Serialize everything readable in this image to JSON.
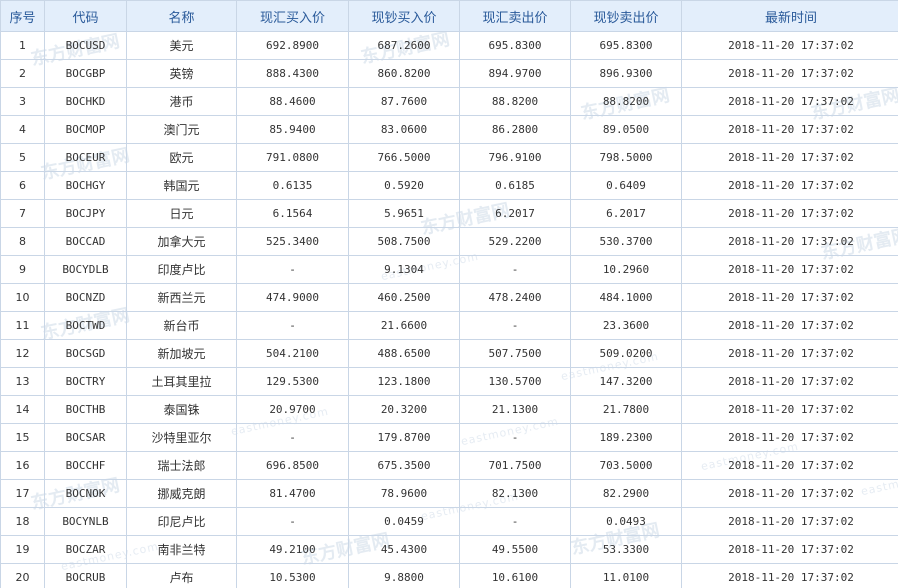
{
  "watermark": {
    "cn": "东方财富网",
    "en": "eastmoney.com"
  },
  "columns": [
    "序号",
    "代码",
    "名称",
    "现汇买入价",
    "现钞买入价",
    "现汇卖出价",
    "现钞卖出价",
    "最新时间"
  ],
  "rows": [
    {
      "idx": "1",
      "code": "BOCUSD",
      "name": "美元",
      "fx_buy": "692.8900",
      "cash_buy": "687.2600",
      "fx_sell": "695.8300",
      "cash_sell": "695.8300",
      "time": "2018-11-20 17:37:02"
    },
    {
      "idx": "2",
      "code": "BOCGBP",
      "name": "英镑",
      "fx_buy": "888.4300",
      "cash_buy": "860.8200",
      "fx_sell": "894.9700",
      "cash_sell": "896.9300",
      "time": "2018-11-20 17:37:02"
    },
    {
      "idx": "3",
      "code": "BOCHKD",
      "name": "港币",
      "fx_buy": "88.4600",
      "cash_buy": "87.7600",
      "fx_sell": "88.8200",
      "cash_sell": "88.8200",
      "time": "2018-11-20 17:37:02"
    },
    {
      "idx": "4",
      "code": "BOCMOP",
      "name": "澳门元",
      "fx_buy": "85.9400",
      "cash_buy": "83.0600",
      "fx_sell": "86.2800",
      "cash_sell": "89.0500",
      "time": "2018-11-20 17:37:02"
    },
    {
      "idx": "5",
      "code": "BOCEUR",
      "name": "欧元",
      "fx_buy": "791.0800",
      "cash_buy": "766.5000",
      "fx_sell": "796.9100",
      "cash_sell": "798.5000",
      "time": "2018-11-20 17:37:02"
    },
    {
      "idx": "6",
      "code": "BOCHGY",
      "name": "韩国元",
      "fx_buy": "0.6135",
      "cash_buy": "0.5920",
      "fx_sell": "0.6185",
      "cash_sell": "0.6409",
      "time": "2018-11-20 17:37:02"
    },
    {
      "idx": "7",
      "code": "BOCJPY",
      "name": "日元",
      "fx_buy": "6.1564",
      "cash_buy": "5.9651",
      "fx_sell": "6.2017",
      "cash_sell": "6.2017",
      "time": "2018-11-20 17:37:02"
    },
    {
      "idx": "8",
      "code": "BOCCAD",
      "name": "加拿大元",
      "fx_buy": "525.3400",
      "cash_buy": "508.7500",
      "fx_sell": "529.2200",
      "cash_sell": "530.3700",
      "time": "2018-11-20 17:37:02"
    },
    {
      "idx": "9",
      "code": "BOCYDLB",
      "name": "印度卢比",
      "fx_buy": "-",
      "cash_buy": "9.1304",
      "fx_sell": "-",
      "cash_sell": "10.2960",
      "time": "2018-11-20 17:37:02"
    },
    {
      "idx": "10",
      "code": "BOCNZD",
      "name": "新西兰元",
      "fx_buy": "474.9000",
      "cash_buy": "460.2500",
      "fx_sell": "478.2400",
      "cash_sell": "484.1000",
      "time": "2018-11-20 17:37:02"
    },
    {
      "idx": "11",
      "code": "BOCTWD",
      "name": "新台币",
      "fx_buy": "-",
      "cash_buy": "21.6600",
      "fx_sell": "-",
      "cash_sell": "23.3600",
      "time": "2018-11-20 17:37:02"
    },
    {
      "idx": "12",
      "code": "BOCSGD",
      "name": "新加坡元",
      "fx_buy": "504.2100",
      "cash_buy": "488.6500",
      "fx_sell": "507.7500",
      "cash_sell": "509.0200",
      "time": "2018-11-20 17:37:02"
    },
    {
      "idx": "13",
      "code": "BOCTRY",
      "name": "土耳其里拉",
      "fx_buy": "129.5300",
      "cash_buy": "123.1800",
      "fx_sell": "130.5700",
      "cash_sell": "147.3200",
      "time": "2018-11-20 17:37:02"
    },
    {
      "idx": "14",
      "code": "BOCTHB",
      "name": "泰国铢",
      "fx_buy": "20.9700",
      "cash_buy": "20.3200",
      "fx_sell": "21.1300",
      "cash_sell": "21.7800",
      "time": "2018-11-20 17:37:02"
    },
    {
      "idx": "15",
      "code": "BOCSAR",
      "name": "沙特里亚尔",
      "fx_buy": "-",
      "cash_buy": "179.8700",
      "fx_sell": "-",
      "cash_sell": "189.2300",
      "time": "2018-11-20 17:37:02"
    },
    {
      "idx": "16",
      "code": "BOCCHF",
      "name": "瑞士法郎",
      "fx_buy": "696.8500",
      "cash_buy": "675.3500",
      "fx_sell": "701.7500",
      "cash_sell": "703.5000",
      "time": "2018-11-20 17:37:02"
    },
    {
      "idx": "17",
      "code": "BOCNOK",
      "name": "挪威克朗",
      "fx_buy": "81.4700",
      "cash_buy": "78.9600",
      "fx_sell": "82.1300",
      "cash_sell": "82.2900",
      "time": "2018-11-20 17:37:02"
    },
    {
      "idx": "18",
      "code": "BOCYNLB",
      "name": "印尼卢比",
      "fx_buy": "-",
      "cash_buy": "0.0459",
      "fx_sell": "-",
      "cash_sell": "0.0493",
      "time": "2018-11-20 17:37:02"
    },
    {
      "idx": "19",
      "code": "BOCZAR",
      "name": "南非兰特",
      "fx_buy": "49.2100",
      "cash_buy": "45.4300",
      "fx_sell": "49.5500",
      "cash_sell": "53.3300",
      "time": "2018-11-20 17:37:02"
    },
    {
      "idx": "20",
      "code": "BOCRUB",
      "name": "卢布",
      "fx_buy": "10.5300",
      "cash_buy": "9.8800",
      "fx_sell": "10.6100",
      "cash_sell": "11.0100",
      "time": "2018-11-20 17:37:02"
    }
  ]
}
